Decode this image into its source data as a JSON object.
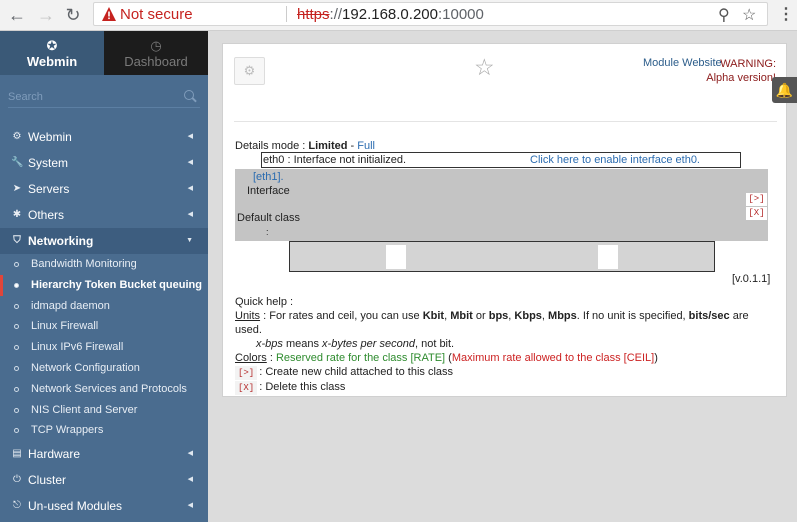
{
  "browser": {
    "back": "←",
    "forward": "→",
    "reload": "↻",
    "security": "Not secure",
    "url_scheme": "https",
    "url_sep": "://",
    "url_host": "192.168.0.200",
    "url_port": ":10000",
    "zoom_icon": "⚲",
    "star_icon": "☆",
    "menu_icon": "⋮"
  },
  "sidebar": {
    "tabs": [
      {
        "label": "Webmin",
        "icon": "✪"
      },
      {
        "label": "Dashboard",
        "icon": "◷"
      }
    ],
    "search_placeholder": "Search",
    "categories": [
      {
        "label": "Webmin",
        "icon": "⚙"
      },
      {
        "label": "System",
        "icon": "🔧"
      },
      {
        "label": "Servers",
        "icon": "➤"
      },
      {
        "label": "Others",
        "icon": "✱"
      },
      {
        "label": "Networking",
        "icon": "⛉"
      },
      {
        "label": "Hardware",
        "icon": "▤"
      },
      {
        "label": "Cluster",
        "icon": "⏻"
      },
      {
        "label": "Un-used Modules",
        "icon": "⎋"
      }
    ],
    "networking_items": [
      "Bandwidth Monitoring",
      "Hierarchy Token Bucket queuing",
      "idmapd daemon",
      "Linux Firewall",
      "Linux IPv6 Firewall",
      "Network Configuration",
      "Network Services and Protocols",
      "NIS Client and Server",
      "TCP Wrappers"
    ]
  },
  "header": {
    "gear_icon": "⚙",
    "star_icon": "☆",
    "module_website": "Module Website",
    "warning_line1": "WARNING:",
    "warning_line2": "Alpha version!"
  },
  "content": {
    "details_prefix": "Details mode : ",
    "details_limited": "Limited",
    "details_sep": " - ",
    "details_full": "Full",
    "iface_msg": "eth0 : Interface not initialized.",
    "iface_link": "Click here to enable interface eth0.",
    "eth1": "[eth1].",
    "interface_label": "Interface",
    "default_class_label": "Default class",
    "colon": ":",
    "add_btn": "[>]",
    "del_btn": "[X]",
    "version": "[v.0.1.1]"
  },
  "help": {
    "title": "Quick help :",
    "units_label": "Units",
    "units_text_a": " : For rates and ceil, you can use ",
    "kbit": "Kbit",
    "comma1": ", ",
    "mbit": "Mbit",
    "or": " or ",
    "bps": "bps",
    "comma2": ", ",
    "kbps": "Kbps",
    "comma3": ", ",
    "mbps_big": "Mbps",
    "units_text_b": ". If no unit is specified, ",
    "bitssec": "bits/sec",
    "units_text_c": " are used.",
    "xbps": "x-bps",
    "means": " means ",
    "xbytes": "x-bytes per second",
    "notbit": ", not bit.",
    "colors_label": "Colors",
    "colors_colon": " : ",
    "reserved": "Reserved rate for the class [RATE]",
    "paren_open": " (",
    "max_rate": "Maximum rate allowed to the class [CEIL]",
    "paren_close": ")",
    "add_code": "[>]",
    "add_text": ": Create new child attached to this class",
    "del_code": "[X]",
    "del_text": ": Delete this class"
  },
  "notification": {
    "icon": "🔔"
  }
}
